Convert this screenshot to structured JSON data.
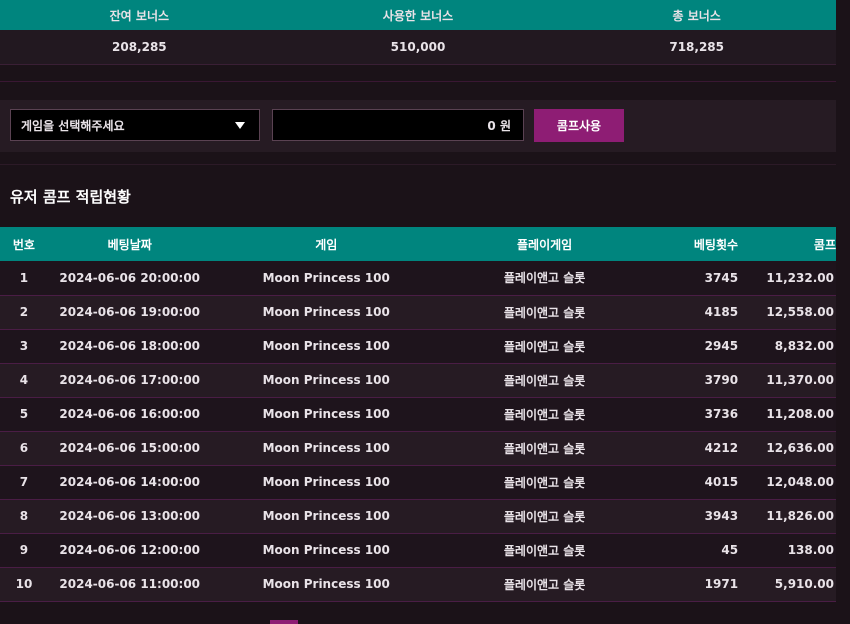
{
  "bonus": {
    "headers": [
      "잔여 보너스",
      "사용한 보너스",
      "총 보너스"
    ],
    "values": [
      "208,285",
      "510,000",
      "718,285"
    ]
  },
  "comp": {
    "select_label": "게임을 선택해주세요",
    "amount": "0 원",
    "button": "콤프사용"
  },
  "section_title": "유저 콤프 적립현황",
  "table": {
    "headers": [
      "번호",
      "베팅날짜",
      "게임",
      "플레이게임",
      "베팅횟수",
      "콤프"
    ],
    "rows": [
      [
        "1",
        "2024-06-06 20:00:00",
        "Moon Princess 100",
        "플레이앤고 슬롯",
        "3745",
        "11,232.00"
      ],
      [
        "2",
        "2024-06-06 19:00:00",
        "Moon Princess 100",
        "플레이앤고 슬롯",
        "4185",
        "12,558.00"
      ],
      [
        "3",
        "2024-06-06 18:00:00",
        "Moon Princess 100",
        "플레이앤고 슬롯",
        "2945",
        "8,832.00"
      ],
      [
        "4",
        "2024-06-06 17:00:00",
        "Moon Princess 100",
        "플레이앤고 슬롯",
        "3790",
        "11,370.00"
      ],
      [
        "5",
        "2024-06-06 16:00:00",
        "Moon Princess 100",
        "플레이앤고 슬롯",
        "3736",
        "11,208.00"
      ],
      [
        "6",
        "2024-06-06 15:00:00",
        "Moon Princess 100",
        "플레이앤고 슬롯",
        "4212",
        "12,636.00"
      ],
      [
        "7",
        "2024-06-06 14:00:00",
        "Moon Princess 100",
        "플레이앤고 슬롯",
        "4015",
        "12,048.00"
      ],
      [
        "8",
        "2024-06-06 13:00:00",
        "Moon Princess 100",
        "플레이앤고 슬롯",
        "3943",
        "11,826.00"
      ],
      [
        "9",
        "2024-06-06 12:00:00",
        "Moon Princess 100",
        "플레이앤고 슬롯",
        "45",
        "138.00"
      ],
      [
        "10",
        "2024-06-06 11:00:00",
        "Moon Princess 100",
        "플레이앤고 슬롯",
        "1971",
        "5,910.00"
      ]
    ]
  },
  "colors": {
    "teal": "#00857e",
    "magenta": "#8e1d74",
    "bg": "#1b1218"
  }
}
